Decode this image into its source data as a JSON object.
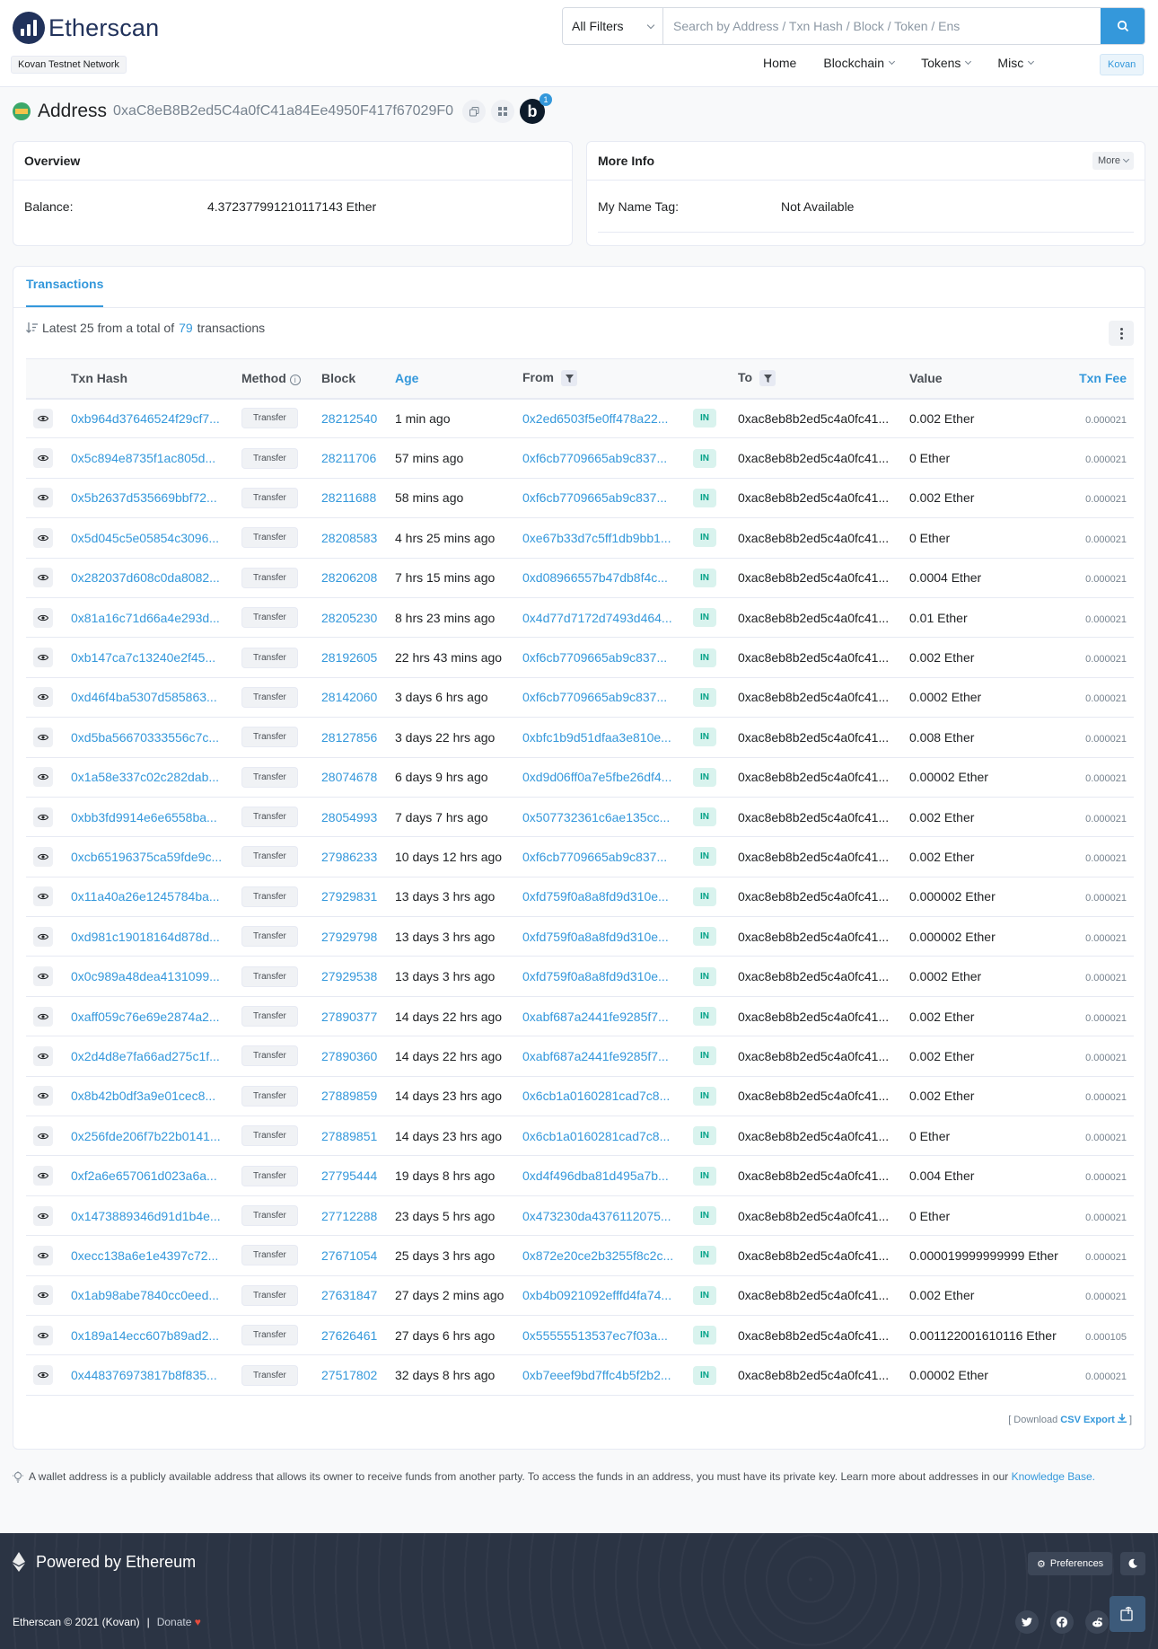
{
  "header": {
    "logo_text": "Etherscan",
    "network_badge": "Kovan Testnet Network",
    "filter_label": "All Filters",
    "search_placeholder": "Search by Address / Txn Hash / Block / Token / Ens",
    "nav": [
      "Home",
      "Blockchain",
      "Tokens",
      "Misc"
    ],
    "network_button": "Kovan"
  },
  "address": {
    "label": "Address",
    "hash": "0xaC8eB8B2ed5C4a0fC41a84Ee4950F417f67029F0",
    "notification_count": "1",
    "bb_letter": "b"
  },
  "overview": {
    "title": "Overview",
    "balance_label": "Balance:",
    "balance_value": "4.372377991210117143 Ether"
  },
  "more_info": {
    "title": "More Info",
    "more_button": "More",
    "name_tag_label": "My Name Tag:",
    "name_tag_value": "Not Available"
  },
  "transactions": {
    "tab_label": "Transactions",
    "summary_prefix": "Latest 25 from a total of",
    "summary_count": "79",
    "summary_suffix": "transactions",
    "columns": [
      "Txn Hash",
      "Method",
      "Block",
      "Age",
      "From",
      "To",
      "Value",
      "Txn Fee"
    ],
    "to_address": "0xac8eb8b2ed5c4a0fc41...",
    "method": "Transfer",
    "direction": "IN",
    "rows": [
      {
        "hash": "0xb964d37646524f29cf7...",
        "block": "28212540",
        "age": "1 min ago",
        "from": "0x2ed6503f5e0ff478a22...",
        "value": "0.002 Ether",
        "fee": "0.000021"
      },
      {
        "hash": "0x5c894e8735f1ac805d...",
        "block": "28211706",
        "age": "57 mins ago",
        "from": "0xf6cb7709665ab9c837...",
        "value": "0 Ether",
        "fee": "0.000021"
      },
      {
        "hash": "0x5b2637d535669bbf72...",
        "block": "28211688",
        "age": "58 mins ago",
        "from": "0xf6cb7709665ab9c837...",
        "value": "0.002 Ether",
        "fee": "0.000021"
      },
      {
        "hash": "0x5d045c5e05854c3096...",
        "block": "28208583",
        "age": "4 hrs 25 mins ago",
        "from": "0xe67b33d7c5ff1db9bb1...",
        "value": "0 Ether",
        "fee": "0.000021"
      },
      {
        "hash": "0x282037d608c0da8082...",
        "block": "28206208",
        "age": "7 hrs 15 mins ago",
        "from": "0xd08966557b47db8f4c...",
        "value": "0.0004 Ether",
        "fee": "0.000021"
      },
      {
        "hash": "0x81a16c71d66a4e293d...",
        "block": "28205230",
        "age": "8 hrs 23 mins ago",
        "from": "0x4d77d7172d7493d464...",
        "value": "0.01 Ether",
        "fee": "0.000021"
      },
      {
        "hash": "0xb147ca7c13240e2f45...",
        "block": "28192605",
        "age": "22 hrs 43 mins ago",
        "from": "0xf6cb7709665ab9c837...",
        "value": "0.002 Ether",
        "fee": "0.000021"
      },
      {
        "hash": "0xd46f4ba5307d585863...",
        "block": "28142060",
        "age": "3 days 6 hrs ago",
        "from": "0xf6cb7709665ab9c837...",
        "value": "0.0002 Ether",
        "fee": "0.000021"
      },
      {
        "hash": "0xd5ba56670333556c7c...",
        "block": "28127856",
        "age": "3 days 22 hrs ago",
        "from": "0xbfc1b9d51dfaa3e810e...",
        "value": "0.008 Ether",
        "fee": "0.000021"
      },
      {
        "hash": "0x1a58e337c02c282dab...",
        "block": "28074678",
        "age": "6 days 9 hrs ago",
        "from": "0xd9d06ff0a7e5fbe26df4...",
        "value": "0.00002 Ether",
        "fee": "0.000021"
      },
      {
        "hash": "0xbb3fd9914e6e6558ba...",
        "block": "28054993",
        "age": "7 days 7 hrs ago",
        "from": "0x507732361c6ae135cc...",
        "value": "0.002 Ether",
        "fee": "0.000021"
      },
      {
        "hash": "0xcb65196375ca59fde9c...",
        "block": "27986233",
        "age": "10 days 12 hrs ago",
        "from": "0xf6cb7709665ab9c837...",
        "value": "0.002 Ether",
        "fee": "0.000021"
      },
      {
        "hash": "0x11a40a26e1245784ba...",
        "block": "27929831",
        "age": "13 days 3 hrs ago",
        "from": "0xfd759f0a8a8fd9d310e...",
        "value": "0.000002 Ether",
        "fee": "0.000021"
      },
      {
        "hash": "0xd981c19018164d878d...",
        "block": "27929798",
        "age": "13 days 3 hrs ago",
        "from": "0xfd759f0a8a8fd9d310e...",
        "value": "0.000002 Ether",
        "fee": "0.000021"
      },
      {
        "hash": "0x0c989a48dea4131099...",
        "block": "27929538",
        "age": "13 days 3 hrs ago",
        "from": "0xfd759f0a8a8fd9d310e...",
        "value": "0.0002 Ether",
        "fee": "0.000021"
      },
      {
        "hash": "0xaff059c76e69e2874a2...",
        "block": "27890377",
        "age": "14 days 22 hrs ago",
        "from": "0xabf687a2441fe9285f7...",
        "value": "0.002 Ether",
        "fee": "0.000021"
      },
      {
        "hash": "0x2d4d8e7fa66ad275c1f...",
        "block": "27890360",
        "age": "14 days 22 hrs ago",
        "from": "0xabf687a2441fe9285f7...",
        "value": "0.002 Ether",
        "fee": "0.000021"
      },
      {
        "hash": "0x8b42b0df3a9e01cec8...",
        "block": "27889859",
        "age": "14 days 23 hrs ago",
        "from": "0x6cb1a0160281cad7c8...",
        "value": "0.002 Ether",
        "fee": "0.000021"
      },
      {
        "hash": "0x256fde206f7b22b0141...",
        "block": "27889851",
        "age": "14 days 23 hrs ago",
        "from": "0x6cb1a0160281cad7c8...",
        "value": "0 Ether",
        "fee": "0.000021"
      },
      {
        "hash": "0xf2a6e657061d023a6a...",
        "block": "27795444",
        "age": "19 days 8 hrs ago",
        "from": "0xd4f496dba81d495a7b...",
        "value": "0.004 Ether",
        "fee": "0.000021"
      },
      {
        "hash": "0x1473889346d91d1b4e...",
        "block": "27712288",
        "age": "23 days 5 hrs ago",
        "from": "0x473230da4376112075...",
        "value": "0 Ether",
        "fee": "0.000021"
      },
      {
        "hash": "0xecc138a6e1e4397c72...",
        "block": "27671054",
        "age": "25 days 3 hrs ago",
        "from": "0x872e20ce2b3255f8c2c...",
        "value": "0.000019999999999 Ether",
        "fee": "0.000021"
      },
      {
        "hash": "0x1ab98abe7840cc0eed...",
        "block": "27631847",
        "age": "27 days 2 mins ago",
        "from": "0xb4b0921092efffd4fa74...",
        "value": "0.002 Ether",
        "fee": "0.000021"
      },
      {
        "hash": "0x189a14ecc607b89ad2...",
        "block": "27626461",
        "age": "27 days 6 hrs ago",
        "from": "0x55555513537ec7f03a...",
        "value": "0.001122001610116 Ether",
        "fee": "0.000105"
      },
      {
        "hash": "0x448376973817b8f835...",
        "block": "27517802",
        "age": "32 days 8 hrs ago",
        "from": "0xb7eeef9bd7ffc4b5f2b2...",
        "value": "0.00002 Ether",
        "fee": "0.000021"
      }
    ],
    "download_prefix": "[ Download",
    "csv_export": "CSV Export",
    "download_suffix": "]"
  },
  "note": {
    "text": "A wallet address is a publicly available address that allows its owner to receive funds from another party. To access the funds in an address, you must have its private key. Learn more about addresses in our",
    "link": "Knowledge Base."
  },
  "footer": {
    "powered": "Powered by Ethereum",
    "preferences": "Preferences",
    "copyright": "Etherscan © 2021 (Kovan)",
    "separator": "|",
    "donate": "Donate"
  }
}
